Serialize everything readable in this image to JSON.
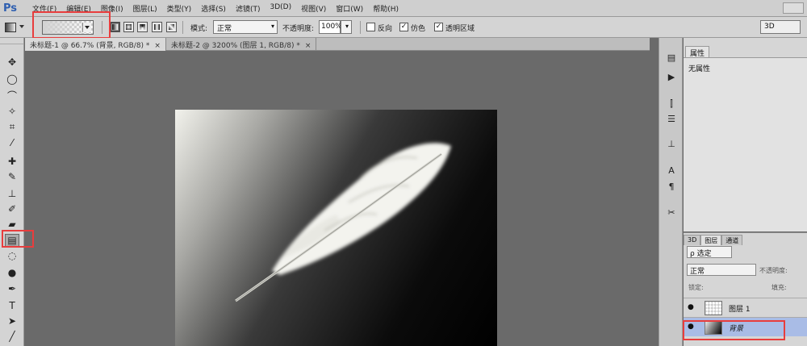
{
  "app": {
    "logo": "Ps"
  },
  "menu": [
    "文件(F)",
    "编辑(E)",
    "图像(I)",
    "图层(L)",
    "类型(Y)",
    "选择(S)",
    "滤镜(T)",
    "3D(D)",
    "视图(V)",
    "窗口(W)",
    "帮助(H)"
  ],
  "options": {
    "mode_label": "模式:",
    "mode_value": "正常",
    "opacity_label": "不透明度:",
    "opacity_value": "100%",
    "reverse_label": "反向",
    "dither_label": "仿色",
    "transparency_label": "透明区域",
    "workspace": "3D"
  },
  "documents": {
    "tabs": [
      {
        "label": "未标题-1 @ 66.7% (背景, RGB/8) *",
        "close": "×"
      },
      {
        "label": "未标题-2 @ 3200% (图层 1, RGB/8) *",
        "close": "×"
      }
    ]
  },
  "properties": {
    "tab": "属性",
    "empty": "无属性"
  },
  "layers": {
    "tabs": [
      "3D",
      "图层",
      "通道"
    ],
    "filter": "ρ 选定",
    "blend": "正常",
    "opacity_label": "不透明度:",
    "lock_label": "锁定:",
    "fill_label": "填充:",
    "rows": [
      {
        "name": "图层 1",
        "visible": "●"
      },
      {
        "name": "背景",
        "visible": "●"
      }
    ]
  },
  "colors": {
    "highlight": "#e83d3d",
    "selected_layer": "#a9bce6",
    "logo": "#2f5fb0"
  }
}
